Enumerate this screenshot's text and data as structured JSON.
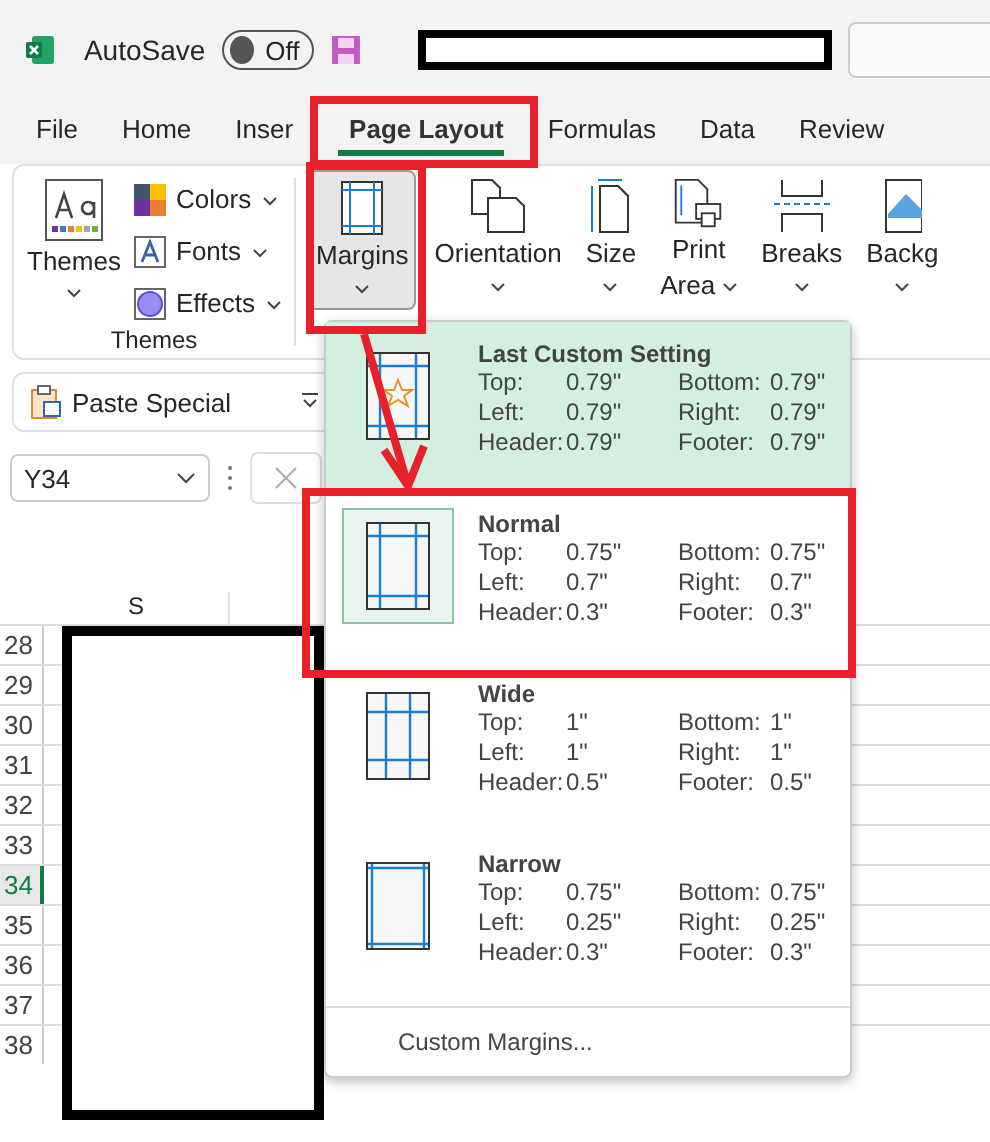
{
  "title_bar": {
    "autosave_label": "AutoSave",
    "autosave_toggle": {
      "label": "Off",
      "on": false
    }
  },
  "tabs": [
    {
      "label": "File",
      "selected": false
    },
    {
      "label": "Home",
      "selected": false
    },
    {
      "label": "Inser",
      "selected": false
    },
    {
      "label": "Page Layout",
      "selected": true
    },
    {
      "label": "Formulas",
      "selected": false
    },
    {
      "label": "Data",
      "selected": false
    },
    {
      "label": "Review",
      "selected": false
    }
  ],
  "ribbon": {
    "themes_group": {
      "themes_button": "Themes",
      "colors": "Colors",
      "fonts": "Fonts",
      "effects": "Effects",
      "group_label": "Themes"
    },
    "page_setup_buttons": [
      {
        "kind": "margins",
        "lines": [
          "Margins"
        ],
        "selected": true
      },
      {
        "kind": "orientation",
        "lines": [
          "Orientation"
        ],
        "selected": false
      },
      {
        "kind": "size",
        "lines": [
          "Size"
        ],
        "selected": false
      },
      {
        "kind": "print-area",
        "lines": [
          "Print",
          "Area"
        ],
        "selected": false
      },
      {
        "kind": "breaks",
        "lines": [
          "Breaks"
        ],
        "selected": false
      },
      {
        "kind": "background",
        "lines": [
          "Backg"
        ],
        "selected": false
      }
    ]
  },
  "quick_bar": {
    "label": "Paste Special"
  },
  "name_box": {
    "value": "Y34"
  },
  "sheet": {
    "column": "S",
    "rows": [
      {
        "label": "28",
        "selected": false
      },
      {
        "label": "29",
        "selected": false
      },
      {
        "label": "30",
        "selected": false
      },
      {
        "label": "31",
        "selected": false
      },
      {
        "label": "32",
        "selected": false
      },
      {
        "label": "33",
        "selected": false
      },
      {
        "label": "34",
        "selected": true
      },
      {
        "label": "35",
        "selected": false
      },
      {
        "label": "36",
        "selected": false
      },
      {
        "label": "37",
        "selected": false
      },
      {
        "label": "38",
        "selected": false
      }
    ]
  },
  "margins_menu": {
    "options": [
      {
        "kind": "custom",
        "name": "Last Custom Setting",
        "highlighted": true,
        "selected": false,
        "values": [
          {
            "label": "Top:",
            "value": "0.79\""
          },
          {
            "label": "Bottom:",
            "value": "0.79\""
          },
          {
            "label": "Left:",
            "value": "0.79\""
          },
          {
            "label": "Right:",
            "value": "0.79\""
          },
          {
            "label": "Header:",
            "value": "0.79\""
          },
          {
            "label": "Footer:",
            "value": "0.79\""
          }
        ]
      },
      {
        "kind": "normal",
        "name": "Normal",
        "highlighted": false,
        "selected": true,
        "values": [
          {
            "label": "Top:",
            "value": "0.75\""
          },
          {
            "label": "Bottom:",
            "value": "0.75\""
          },
          {
            "label": "Left:",
            "value": "0.7\""
          },
          {
            "label": "Right:",
            "value": "0.7\""
          },
          {
            "label": "Header:",
            "value": "0.3\""
          },
          {
            "label": "Footer:",
            "value": "0.3\""
          }
        ]
      },
      {
        "kind": "wide",
        "name": "Wide",
        "highlighted": false,
        "selected": false,
        "values": [
          {
            "label": "Top:",
            "value": "1\""
          },
          {
            "label": "Bottom:",
            "value": "1\""
          },
          {
            "label": "Left:",
            "value": "1\""
          },
          {
            "label": "Right:",
            "value": "1\""
          },
          {
            "label": "Header:",
            "value": "0.5\""
          },
          {
            "label": "Footer:",
            "value": "0.5\""
          }
        ]
      },
      {
        "kind": "narrow",
        "name": "Narrow",
        "highlighted": false,
        "selected": false,
        "values": [
          {
            "label": "Top:",
            "value": "0.75\""
          },
          {
            "label": "Bottom:",
            "value": "0.75\""
          },
          {
            "label": "Left:",
            "value": "0.25\""
          },
          {
            "label": "Right:",
            "value": "0.25\""
          },
          {
            "label": "Header:",
            "value": "0.3\""
          },
          {
            "label": "Footer:",
            "value": "0.3\""
          }
        ]
      }
    ],
    "footer": "Custom Margins..."
  }
}
